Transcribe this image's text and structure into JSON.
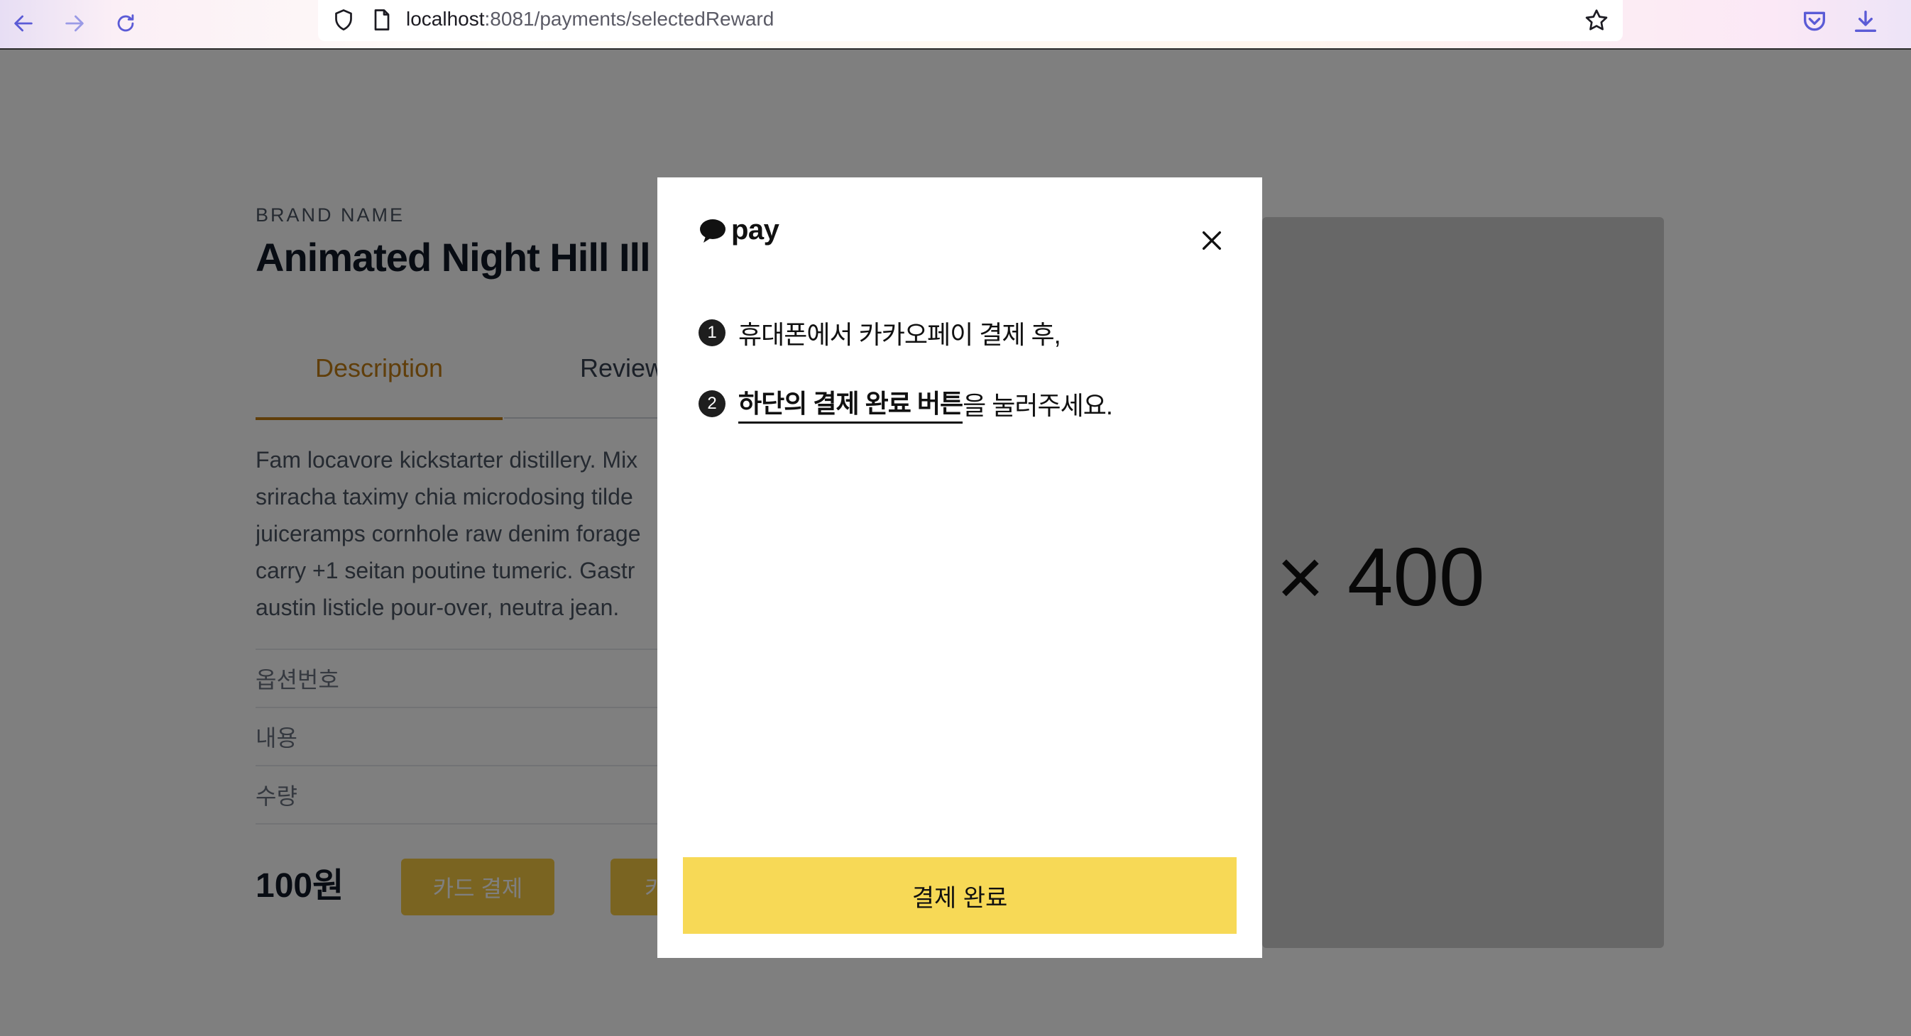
{
  "browser": {
    "url_host": "localhost",
    "url_path": ":8081/payments/selectedReward",
    "icons": [
      "back-arrow-icon",
      "forward-arrow-icon",
      "reload-icon",
      "shield-icon",
      "page-icon",
      "star-icon",
      "pocket-icon",
      "download-icon"
    ]
  },
  "product": {
    "brand": "BRAND NAME",
    "title": "Animated Night Hill Ill",
    "tabs": [
      "Description",
      "Reviews"
    ],
    "description_lines": [
      "Fam locavore kickstarter distillery. Mix",
      "sriracha taximy chia microdosing tilde",
      "juiceramps cornhole raw denim forage",
      "carry +1 seitan poutine tumeric. Gastr",
      "austin listicle pour-over, neutra jean."
    ],
    "options": [
      "옵션번호",
      "내용",
      "수량"
    ],
    "price": "100원",
    "card_button": "카드 결제",
    "other_button_partial": "카",
    "image_placeholder": "× 400"
  },
  "modal": {
    "logo_text": "pay",
    "step1_num": "1",
    "step1_text": "휴대폰에서 카카오페이 결제 후,",
    "step2_num": "2",
    "step2_bold": "하단의 결제 완료 버튼",
    "step2_rest": "을 눌러주세요.",
    "confirm_button": "결제 완료"
  },
  "colors": {
    "accent": "#c07d14",
    "kakao_yellow": "#f7d956",
    "overlay": "rgba(0,0,0,0.5)"
  }
}
